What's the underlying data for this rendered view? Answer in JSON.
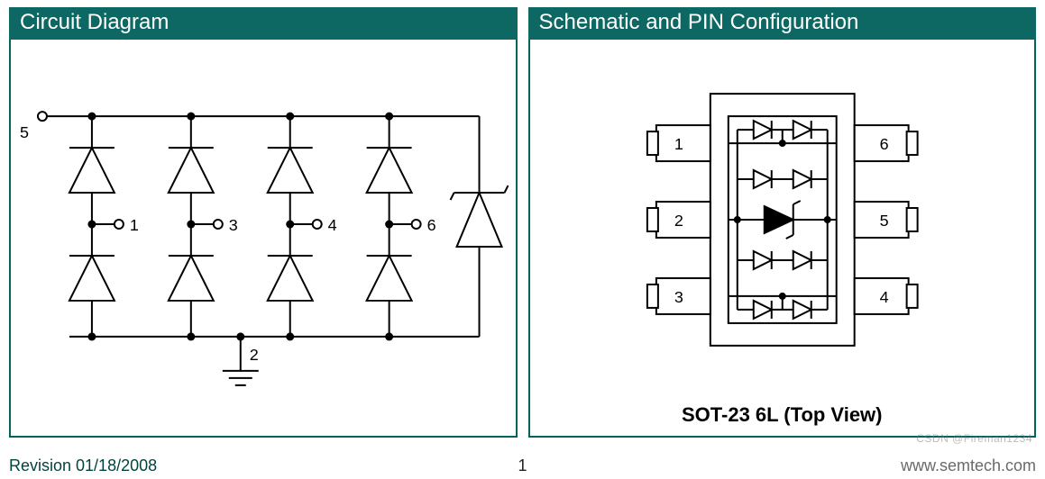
{
  "panels": {
    "left": {
      "title": "Circuit Diagram"
    },
    "right": {
      "title": "Schematic and PIN Configuration",
      "caption": "SOT-23 6L (Top View)"
    }
  },
  "circuit": {
    "io_pins": [
      "1",
      "3",
      "4",
      "6"
    ],
    "top_rail_pin": "5",
    "ground_pin": "2"
  },
  "package": {
    "pins_left": [
      "1",
      "2",
      "3"
    ],
    "pins_right": [
      "6",
      "5",
      "4"
    ]
  },
  "footer": {
    "revision": "Revision 01/18/2008",
    "page": "1",
    "url": "www.semtech.com"
  },
  "watermark": "CSDN @Fireman1234"
}
